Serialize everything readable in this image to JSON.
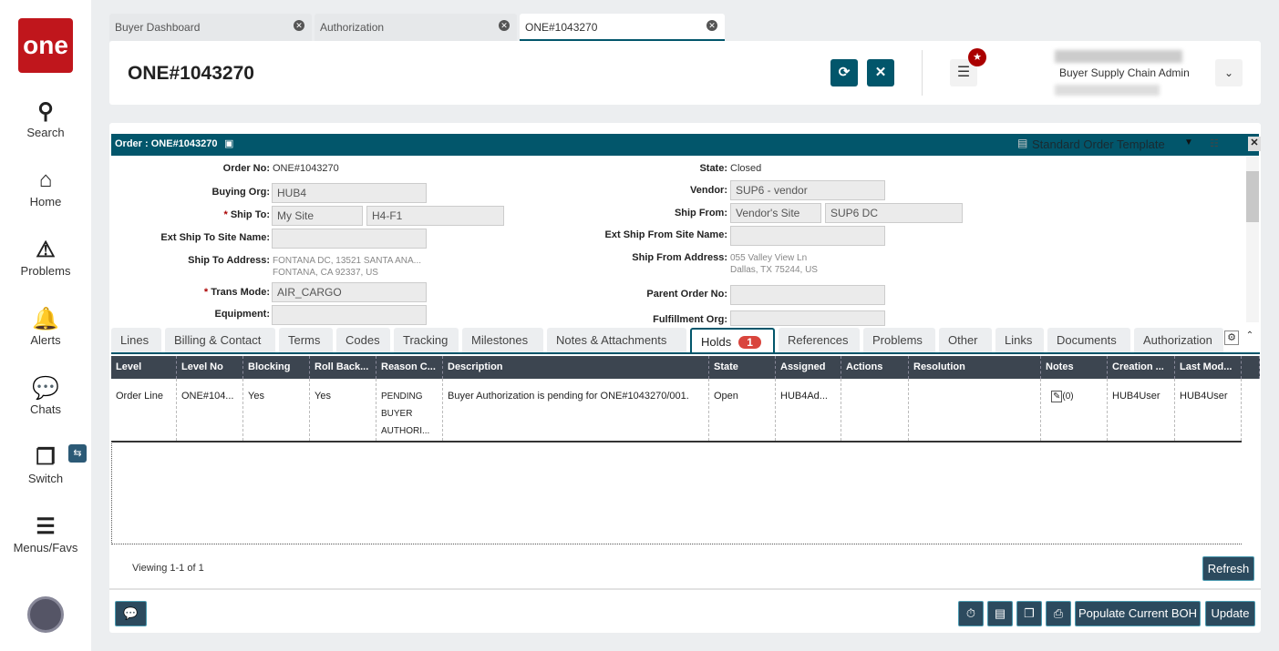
{
  "sidebar": {
    "logo": "one",
    "items": [
      {
        "label": "Search"
      },
      {
        "label": "Home"
      },
      {
        "label": "Problems"
      },
      {
        "label": "Alerts"
      },
      {
        "label": "Chats"
      },
      {
        "label": "Switch"
      },
      {
        "label": "Menus/Favs"
      }
    ]
  },
  "tabs": [
    {
      "label": "Buyer Dashboard"
    },
    {
      "label": "Authorization"
    },
    {
      "label": "ONE#1043270"
    }
  ],
  "header": {
    "title": "ONE#1043270",
    "user_role": "Buyer Supply Chain Admin"
  },
  "panel": {
    "title": "Order : ONE#1043270",
    "template": "Standard Order Template"
  },
  "form": {
    "order_no": {
      "label": "Order No:",
      "value": "ONE#1043270"
    },
    "buying_org": {
      "label": "Buying Org:",
      "value": "HUB4"
    },
    "ship_to": {
      "label": "Ship To:",
      "site": "My Site",
      "location": "H4-F1"
    },
    "ext_ship_to": {
      "label": "Ext Ship To Site Name:",
      "value": ""
    },
    "ship_to_address": {
      "label": "Ship To Address:",
      "line1": "FONTANA DC, 13521 SANTA ANA...",
      "line2": "FONTANA, CA 92337, US"
    },
    "trans_mode": {
      "label": "Trans Mode:",
      "value": "AIR_CARGO"
    },
    "equipment": {
      "label": "Equipment:",
      "value": ""
    },
    "state": {
      "label": "State:",
      "value": "Closed"
    },
    "vendor": {
      "label": "Vendor:",
      "value": "SUP6 - vendor"
    },
    "ship_from": {
      "label": "Ship From:",
      "site": "Vendor's Site",
      "location": "SUP6 DC"
    },
    "ext_ship_from": {
      "label": "Ext Ship From Site Name:",
      "value": ""
    },
    "ship_from_address": {
      "label": "Ship From Address:",
      "line1": "055 Valley View Ln",
      "line2": "Dallas, TX 75244, US"
    },
    "parent_order": {
      "label": "Parent Order No:",
      "value": ""
    },
    "fulfillment_org": {
      "label": "Fulfillment Org:",
      "value": ""
    }
  },
  "subtabs": [
    {
      "label": "Lines"
    },
    {
      "label": "Billing & Contact"
    },
    {
      "label": "Terms"
    },
    {
      "label": "Codes"
    },
    {
      "label": "Tracking"
    },
    {
      "label": "Milestones"
    },
    {
      "label": "Notes & Attachments"
    },
    {
      "label": "Holds",
      "badge": "1"
    },
    {
      "label": "References"
    },
    {
      "label": "Problems"
    },
    {
      "label": "Other"
    },
    {
      "label": "Links"
    },
    {
      "label": "Documents"
    },
    {
      "label": "Authorization"
    }
  ],
  "grid": {
    "columns": [
      "Level",
      "Level No",
      "Blocking",
      "Roll Back...",
      "Reason C...",
      "Description",
      "State",
      "Assigned ...",
      "Actions",
      "Resolution",
      "Notes",
      "Creation ...",
      "Last Mod..."
    ],
    "rows": [
      [
        "Order Line",
        "ONE#104...",
        "Yes",
        "Yes",
        "PENDING BUYER AUTHORI...",
        "Buyer Authorization is pending for ONE#1043270/001.",
        "Open",
        "HUB4Ad...",
        "",
        "",
        "(0)",
        "HUB4User",
        "HUB4User"
      ]
    ],
    "viewing": "Viewing 1-1 of 1",
    "refresh": "Refresh"
  },
  "footer": {
    "populate": "Populate Current BOH",
    "update": "Update"
  }
}
